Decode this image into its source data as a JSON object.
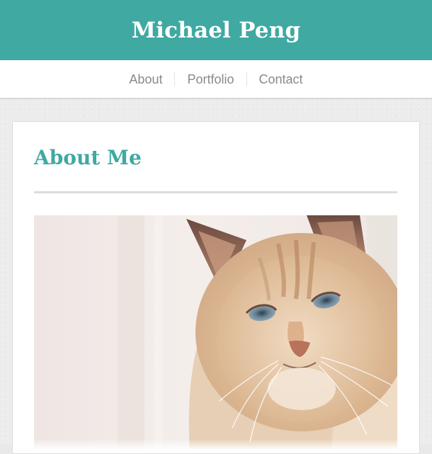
{
  "site": {
    "title": "Michael Peng"
  },
  "nav": {
    "items": [
      {
        "label": "About"
      },
      {
        "label": "Portfolio"
      },
      {
        "label": "Contact"
      }
    ]
  },
  "main": {
    "heading": "About Me",
    "photo": {
      "subject": "cat-photo"
    }
  },
  "colors": {
    "accent": "#3fa9a2",
    "nav_text": "#8a8a8a",
    "background": "#ececec"
  }
}
